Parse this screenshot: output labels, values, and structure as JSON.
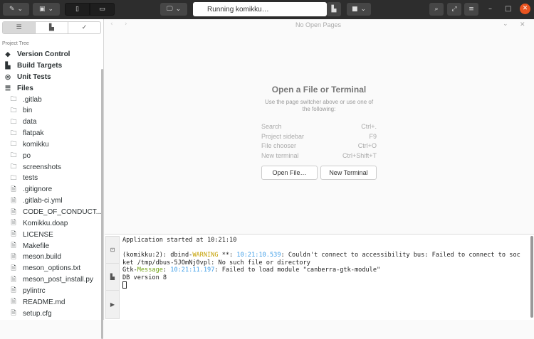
{
  "header": {
    "run_status": "Running komikku…"
  },
  "sidebar": {
    "section_title": "Project Tree",
    "groups": [
      {
        "label": "Version Control",
        "icon": "git-icon"
      },
      {
        "label": "Build Targets",
        "icon": "build-icon"
      },
      {
        "label": "Unit Tests",
        "icon": "tests-icon"
      },
      {
        "label": "Files",
        "icon": "list-icon"
      }
    ],
    "folders": [
      ".gitlab",
      "bin",
      "data",
      "flatpak",
      "komikku",
      "po",
      "screenshots",
      "tests"
    ],
    "files": [
      ".gitignore",
      ".gitlab-ci.yml",
      "CODE_OF_CONDUCT....",
      "Komikku.doap",
      "LICENSE",
      "Makefile",
      "meson.build",
      "meson_options.txt",
      "meson_post_install.py",
      "pylintrc",
      "README.md",
      "setup.cfg"
    ]
  },
  "main": {
    "pages_label": "No Open Pages",
    "title": "Open a File or Terminal",
    "subtitle": "Use the page switcher above or use one of the following:",
    "shortcuts": [
      {
        "label": "Search",
        "key": "Ctrl+."
      },
      {
        "label": "Project sidebar",
        "key": "F9"
      },
      {
        "label": "File chooser",
        "key": "Ctrl+O"
      },
      {
        "label": "New terminal",
        "key": "Ctrl+Shift+T"
      }
    ],
    "open_file": "Open File…",
    "new_terminal": "New Terminal"
  },
  "terminal": {
    "l1": "Application started at 10:21:10",
    "l3a": "(komikku:2): dbind-",
    "l3w": "WARNING",
    "l3b": " **: ",
    "l3t": "10:21:10.539",
    "l3c": ": Couldn't connect to accessibility bus: Failed to connect to soc",
    "l4": "ket /tmp/dbus-5JOmNj0vpl: No such file or directory",
    "l5a": "Gtk-",
    "l5m": "Message",
    "l5b": ": ",
    "l5t": "10:21:11.197",
    "l5c": ": Failed to load module \"canberra-gtk-module\"",
    "l6": "DB version 8"
  },
  "colors": {
    "accent_close": "#e95420",
    "warning": "#c4a000",
    "timestamp": "#3e9ee8",
    "message": "#73a416"
  }
}
